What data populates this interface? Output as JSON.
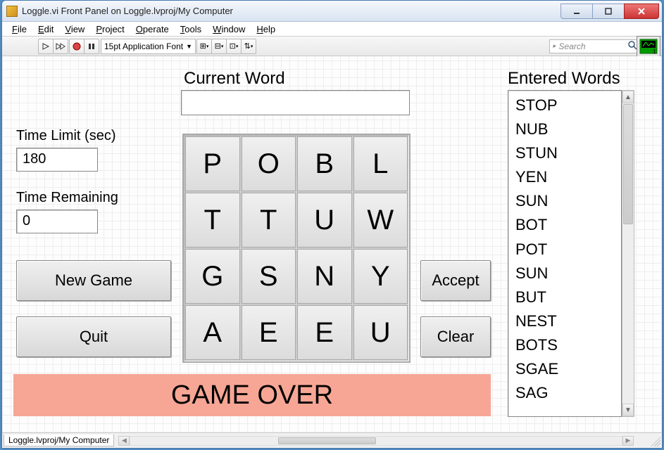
{
  "window": {
    "title": "Loggle.vi Front Panel on Loggle.lvproj/My Computer"
  },
  "menu": {
    "items": [
      "File",
      "Edit",
      "View",
      "Project",
      "Operate",
      "Tools",
      "Window",
      "Help"
    ]
  },
  "toolbar": {
    "font_label": "15pt Application Font",
    "search_placeholder": "Search"
  },
  "labels": {
    "current_word": "Current Word",
    "entered_words": "Entered Words",
    "time_limit": "Time Limit (sec)",
    "time_remaining": "Time Remaining"
  },
  "values": {
    "time_limit": "180",
    "time_remaining": "0",
    "current_word": ""
  },
  "buttons": {
    "new_game": "New Game",
    "quit": "Quit",
    "accept": "Accept",
    "clear": "Clear"
  },
  "board": {
    "rows": [
      [
        "P",
        "O",
        "B",
        "L"
      ],
      [
        "T",
        "T",
        "U",
        "W"
      ],
      [
        "G",
        "S",
        "N",
        "Y"
      ],
      [
        "A",
        "E",
        "E",
        "U"
      ]
    ]
  },
  "entered_words": [
    "STOP",
    "NUB",
    "STUN",
    "YEN",
    "SUN",
    "BOT",
    "POT",
    "SUN",
    "BUT",
    "NEST",
    "BOTS",
    "SGAE",
    "SAG"
  ],
  "status": {
    "message": "GAME OVER",
    "project_path": "Loggle.lvproj/My Computer"
  }
}
